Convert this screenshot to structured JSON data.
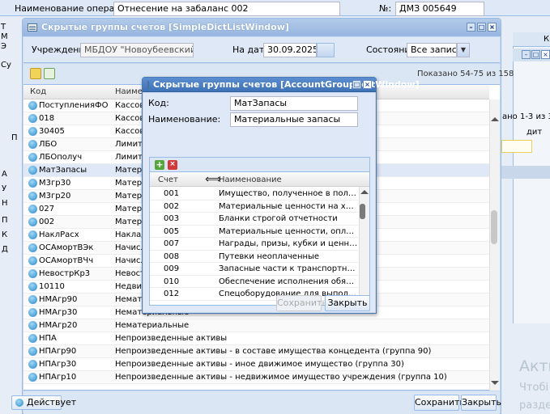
{
  "background": {
    "operation_label": "Наименование операции:",
    "operation_value": "Отнесение на забаланс 002",
    "number_label": "№:",
    "number_value": "ДМЗ 005649",
    "fragments": [
      "Т",
      "М",
      "Э",
      "Су",
      "П",
      "А",
      "У",
      "Н",
      "П",
      "К",
      "Д"
    ],
    "right_pager": "ано 1-3 из 3",
    "right_col": "дит",
    "right_top": "К",
    "status_label": "Действует",
    "watermark_line1": "Акти",
    "watermark_line2": "Чтобі",
    "watermark_line3": "разде"
  },
  "list_window": {
    "title": "Скрытые группы счетов [SimpleDictListWindow]",
    "institution_label": "Учреждение:",
    "institution_value": "МБДОУ \"Новоубеевский детский",
    "date_label": "На дату:",
    "date_value": "30.09.2025",
    "state_label": "Состояние:",
    "state_value": "Все записи",
    "paging": "Показано 54-75 из 158",
    "columns": [
      "Код",
      "Наименование"
    ],
    "rows": [
      {
        "code": "ПоступленияФО",
        "name": "Кассовые"
      },
      {
        "code": "018",
        "name": "Кассовые"
      },
      {
        "code": "30405",
        "name": "Кассовые"
      },
      {
        "code": "ЛБО",
        "name": "Лимиты"
      },
      {
        "code": "ЛБОполуч",
        "name": "Лимиты"
      },
      {
        "code": "МатЗапасы",
        "name": "Материальные"
      },
      {
        "code": "М3гр30",
        "name": "Материальные"
      },
      {
        "code": "М3гр20",
        "name": "Материальные"
      },
      {
        "code": "027",
        "name": "Материальные"
      },
      {
        "code": "002",
        "name": "Материальные"
      },
      {
        "code": "НаклРасх",
        "name": "Накладные"
      },
      {
        "code": "ОСАмортВЭк",
        "name": "Начисление"
      },
      {
        "code": "ОСАмортВЧч",
        "name": "Начисление"
      },
      {
        "code": "НевострКр3",
        "name": "Невостребованные"
      },
      {
        "code": "10110",
        "name": "Недвижимое"
      },
      {
        "code": "НМАгр90",
        "name": "Нематериальные"
      },
      {
        "code": "НМАгр30",
        "name": "Нематериальные"
      },
      {
        "code": "НМАгр20",
        "name": "Нематериальные"
      },
      {
        "code": "НПА",
        "name": "Непроизведенные активы"
      },
      {
        "code": "НПАгр90",
        "name": "Непроизведенные активы - в составе имущества концедента (группа 90)"
      },
      {
        "code": "НПАгр30",
        "name": "Непроизведенные активы - иное движимое имущество (группа 30)"
      },
      {
        "code": "НПАгр10",
        "name": "Непроизведенные активы - недвижимое имущество учреждения (группа 10)"
      }
    ],
    "save_label": "Сохранить",
    "close_label": "Закрыть"
  },
  "edit_window": {
    "title": "Скрытые группы счетов [AccountGroupEditWindow]",
    "code_label": "Код:",
    "code_value": "МатЗапасы",
    "name_label": "Наименование:",
    "name_value": "Материальные запасы",
    "columns": [
      "Счет",
      "Наименование"
    ],
    "rows": [
      {
        "acc": "001",
        "name": "Имущество, полученное в пользование"
      },
      {
        "acc": "002",
        "name": "Материальные ценности на хранении"
      },
      {
        "acc": "003",
        "name": "Бланки строгой отчетности"
      },
      {
        "acc": "005",
        "name": "Материальные ценности, оплаченные по це..."
      },
      {
        "acc": "007",
        "name": "Награды, призы, кубки и ценные подарки, с..."
      },
      {
        "acc": "008",
        "name": "Путевки неоплаченные"
      },
      {
        "acc": "009",
        "name": "Запасные части к транспортным средствам,..."
      },
      {
        "acc": "010",
        "name": "Обеспечение исполнения обязательств"
      },
      {
        "acc": "012",
        "name": "Спецоборудование для выполнения научно..."
      }
    ],
    "save_label": "Сохранить",
    "close_label": "Закрыть"
  }
}
